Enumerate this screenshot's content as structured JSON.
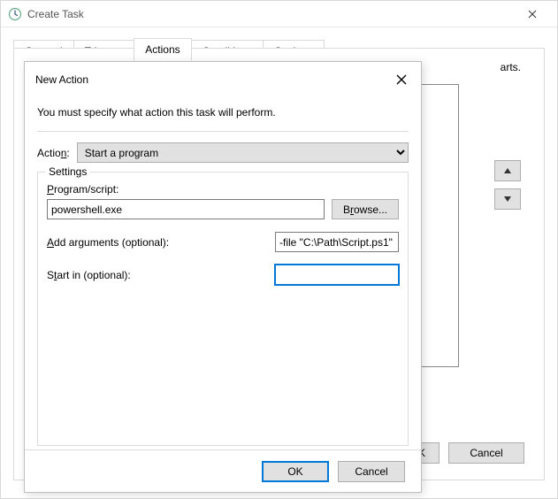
{
  "window": {
    "title": "Create Task",
    "tabs": [
      "General",
      "Triggers",
      "Actions",
      "Conditions",
      "Settings"
    ],
    "active_tab_index": 2,
    "background_hint": "arts.",
    "buttons": {
      "ok_fragment": "K",
      "cancel": "Cancel"
    }
  },
  "dialog": {
    "title": "New Action",
    "instruction": "You must specify what action this task will perform.",
    "action_label": "Action:",
    "action_underline": "A",
    "action_selected": "Start a program",
    "settings_legend": "Settings",
    "program_label": "Program/script:",
    "program_underline": "P",
    "program_value": "powershell.exe",
    "browse_label": "Browse...",
    "browse_underline": "r",
    "args_label": "Add arguments (optional):",
    "args_underline": "A",
    "args_value": "-file \"C:\\Path\\Script.ps1\"",
    "startin_label": "Start in (optional):",
    "startin_underline": "t",
    "startin_value": "",
    "ok": "OK",
    "cancel": "Cancel"
  }
}
